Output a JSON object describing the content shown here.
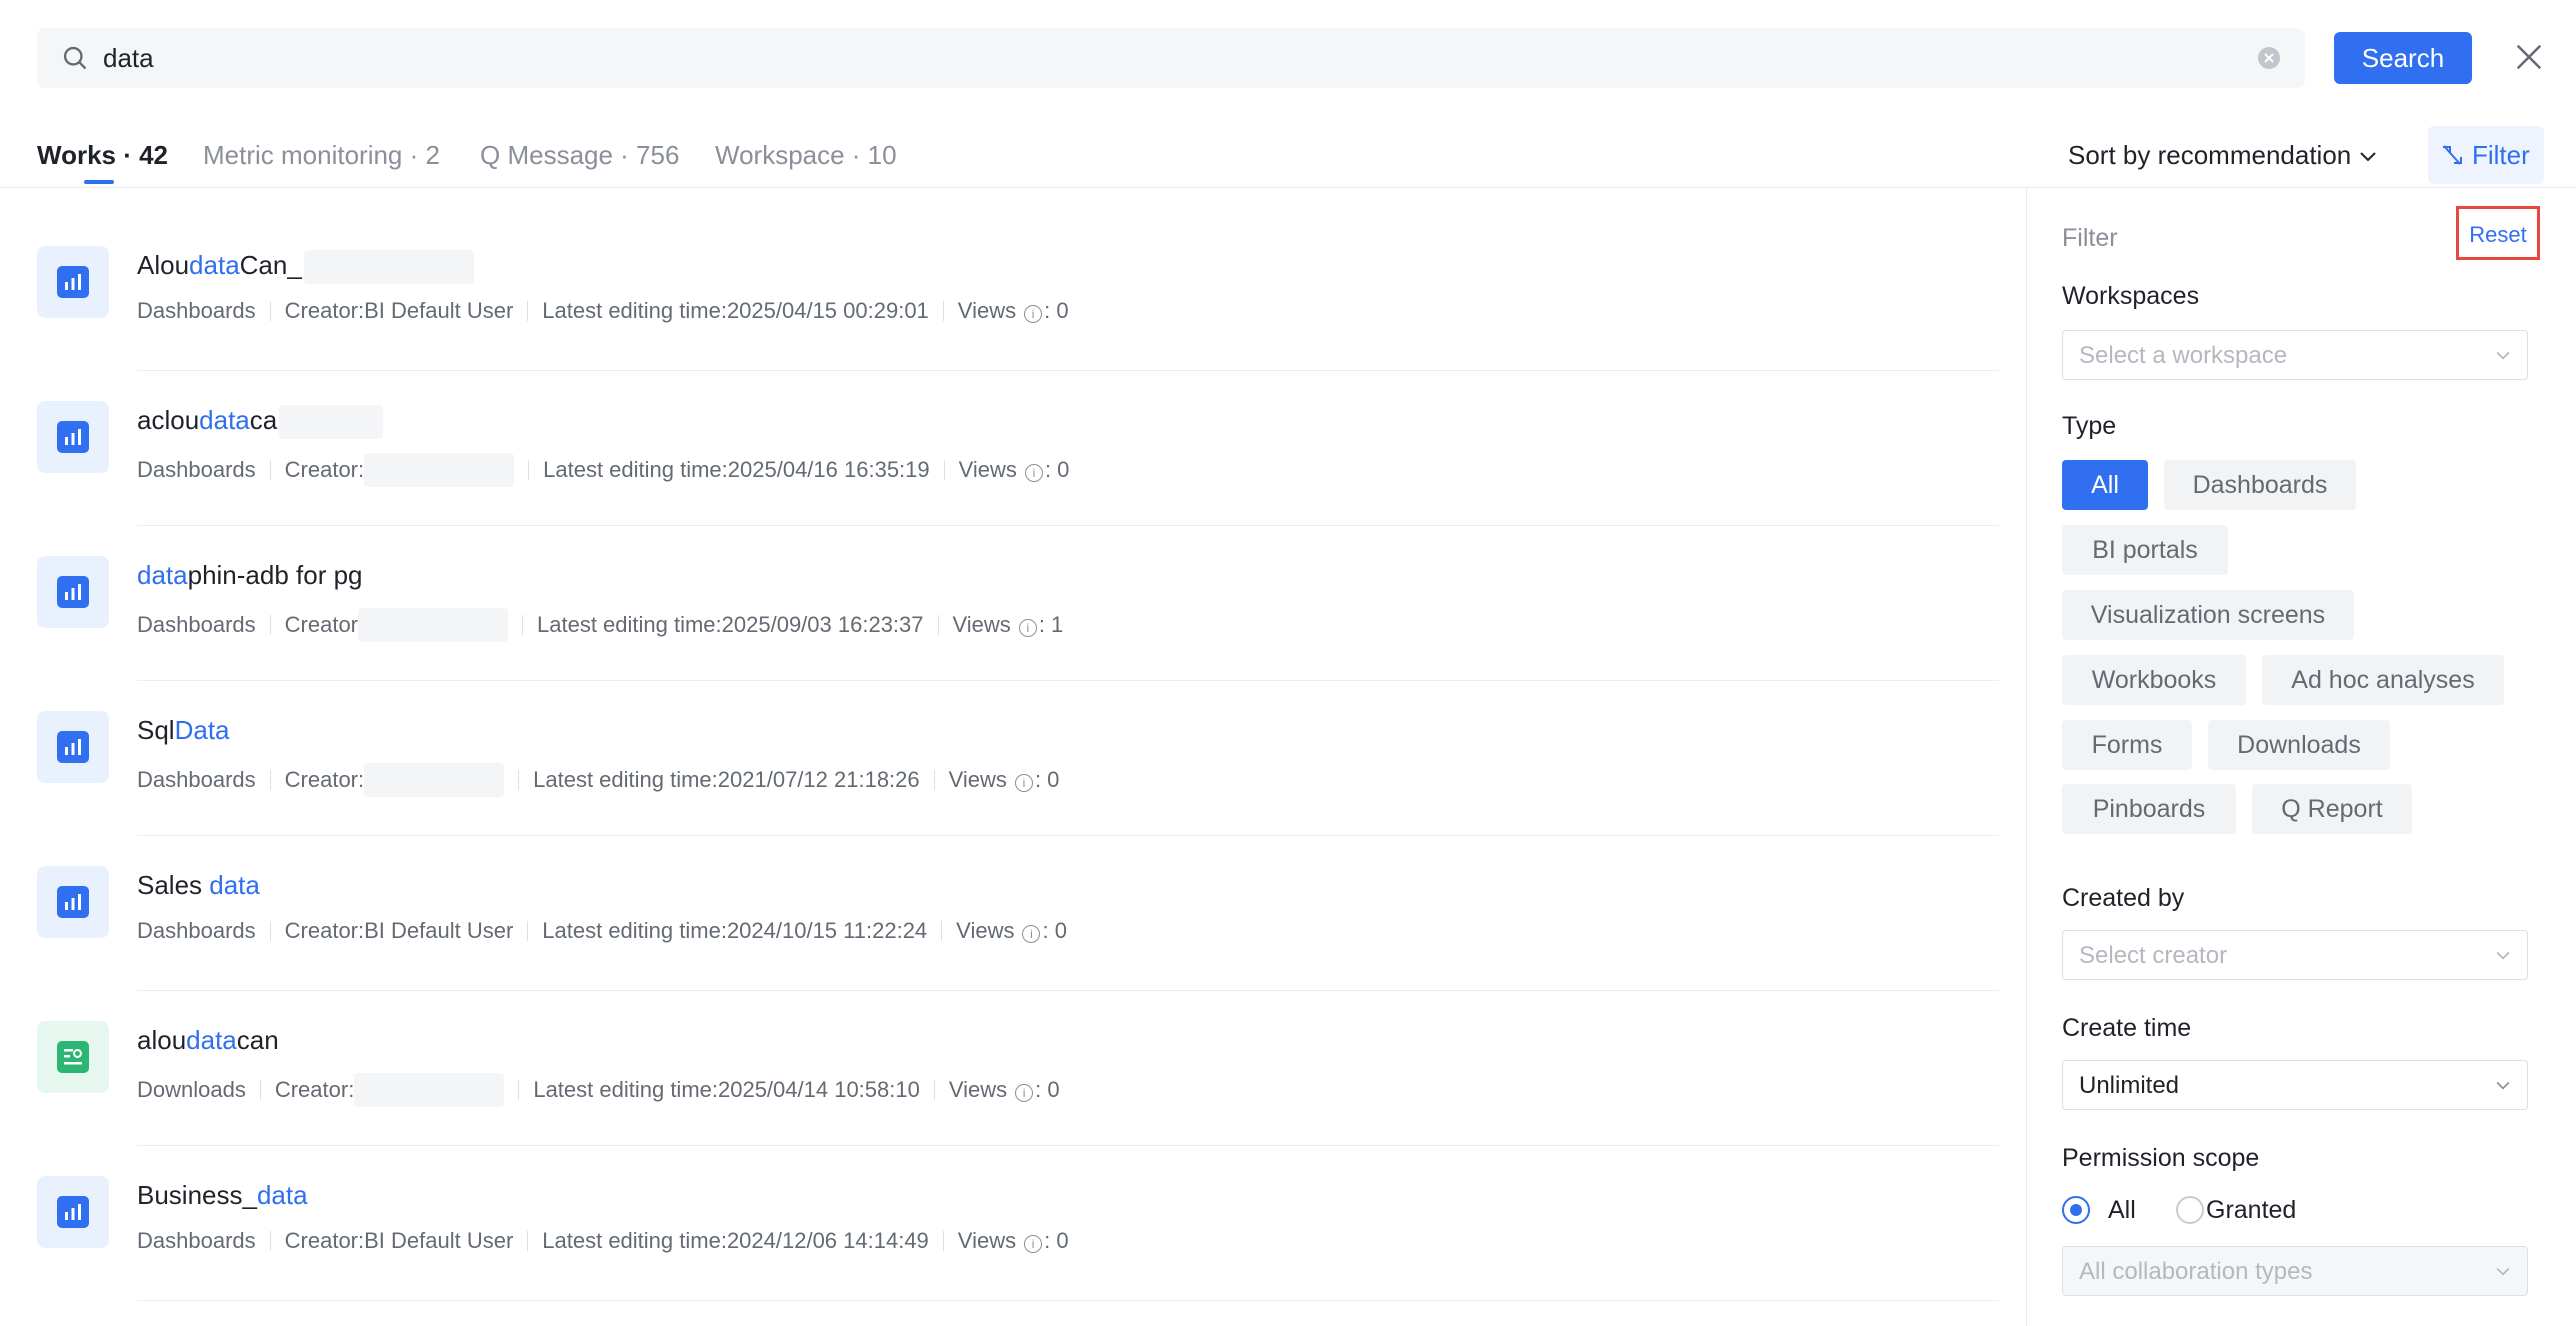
{
  "search": {
    "query": "data",
    "button_label": "Search"
  },
  "tabs": [
    {
      "label": "Works · 42"
    },
    {
      "label": "Metric monitoring · 2"
    },
    {
      "label": "Q Message · 756"
    },
    {
      "label": "Workspace · 10"
    }
  ],
  "sort": {
    "label": "Sort by recommendation"
  },
  "filter_button": {
    "label": "Filter"
  },
  "results": [
    {
      "title_pre": "Alou",
      "title_hl": "data",
      "title_post": "Can_",
      "type": "Dashboards",
      "creator": "Creator:BI Default User",
      "edited": "Latest editing time:2025/04/15 00:29:01",
      "views_label": "Views",
      "views": ": 0",
      "icon": "dashboard-icon"
    },
    {
      "title_pre": "aclou",
      "title_hl": "data",
      "title_post": "ca",
      "type": "Dashboards",
      "creator": "Creator:",
      "edited": "Latest editing time:2025/04/16 16:35:19",
      "views_label": "Views",
      "views": ": 0",
      "icon": "dashboard-icon"
    },
    {
      "title_pre": "",
      "title_hl": "data",
      "title_post": "phin-adb for pg",
      "type": "Dashboards",
      "creator": "Creator",
      "edited": "Latest editing time:2025/09/03 16:23:37",
      "views_label": "Views",
      "views": ": 1",
      "icon": "dashboard-icon"
    },
    {
      "title_pre": "Sql",
      "title_hl": "Data",
      "title_post": "",
      "type": "Dashboards",
      "creator": "Creator:",
      "edited": "Latest editing time:2021/07/12 21:18:26",
      "views_label": "Views",
      "views": ": 0",
      "icon": "dashboard-icon"
    },
    {
      "title_pre": "Sales ",
      "title_hl": "data",
      "title_post": "",
      "type": "Dashboards",
      "creator": "Creator:BI Default User",
      "edited": "Latest editing time:2024/10/15 11:22:24",
      "views_label": "Views",
      "views": ": 0",
      "icon": "dashboard-icon"
    },
    {
      "title_pre": "alou",
      "title_hl": "data",
      "title_post": "can",
      "type": "Downloads",
      "creator": "Creator:",
      "edited": "Latest editing time:2025/04/14 10:58:10",
      "views_label": "Views",
      "views": ": 0",
      "icon": "download-icon"
    },
    {
      "title_pre": "Business_",
      "title_hl": "data",
      "title_post": "",
      "type": "Dashboards",
      "creator": "Creator:BI Default User",
      "edited": "Latest editing time:2024/12/06 14:14:49",
      "views_label": "Views",
      "views": ": 0",
      "icon": "dashboard-icon"
    }
  ],
  "filter_panel": {
    "title": "Filter",
    "reset_label": "Reset",
    "workspaces_label": "Workspaces",
    "workspace_placeholder": "Select a workspace",
    "type_label": "Type",
    "types": [
      "All",
      "Dashboards",
      "BI portals",
      "Visualization screens",
      "Workbooks",
      "Ad hoc analyses",
      "Forms",
      "Downloads",
      "Pinboards",
      "Q Report"
    ],
    "created_by_label": "Created by",
    "creator_placeholder": "Select creator",
    "create_time_label": "Create time",
    "create_time_value": "Unlimited",
    "permission_label": "Permission scope",
    "permission_options": [
      "All",
      "Granted"
    ],
    "collab_placeholder": "All collaboration types"
  },
  "colors": {
    "accent": "#2f6ff0",
    "highlight_box": "#e8473e",
    "download_icon": "#2bb673"
  }
}
